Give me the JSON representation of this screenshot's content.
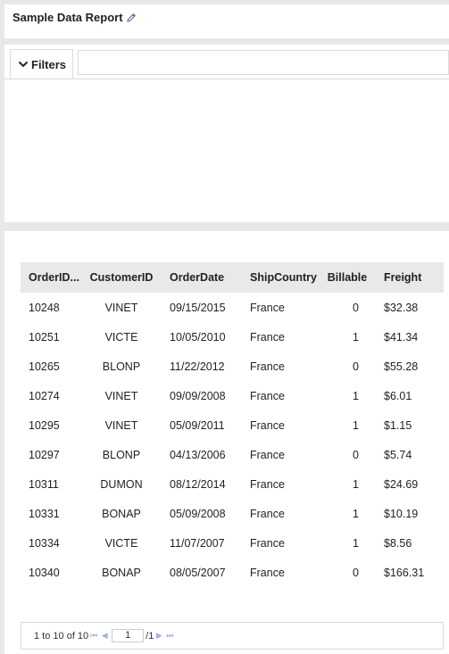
{
  "report": {
    "title": "Sample Data Report",
    "edit_icon": "pencil-icon"
  },
  "filters": {
    "label": "Filters",
    "toggle_icon": "chevron-down-icon"
  },
  "grid": {
    "columns": [
      "OrderID...",
      "CustomerID",
      "OrderDate",
      "ShipCountry",
      "Billable",
      "Freight"
    ],
    "rows": [
      [
        "10248",
        "VINET",
        "09/15/2015",
        "France",
        "0",
        "$32.38"
      ],
      [
        "10251",
        "VICTE",
        "10/05/2010",
        "France",
        "1",
        "$41.34"
      ],
      [
        "10265",
        "BLONP",
        "11/22/2012",
        "France",
        "0",
        "$55.28"
      ],
      [
        "10274",
        "VINET",
        "09/09/2008",
        "France",
        "1",
        "$6.01"
      ],
      [
        "10295",
        "VINET",
        "05/09/2011",
        "France",
        "1",
        "$1.15"
      ],
      [
        "10297",
        "BLONP",
        "04/13/2006",
        "France",
        "0",
        "$5.74"
      ],
      [
        "10311",
        "DUMON",
        "08/12/2014",
        "France",
        "1",
        "$24.69"
      ],
      [
        "10331",
        "BONAP",
        "05/09/2008",
        "France",
        "1",
        "$10.19"
      ],
      [
        "10334",
        "VICTE",
        "11/07/2007",
        "France",
        "1",
        "$8.56"
      ],
      [
        "10340",
        "BONAP",
        "08/05/2007",
        "France",
        "0",
        "$166.31"
      ]
    ]
  },
  "pager": {
    "summary": "1 to 10 of 10",
    "page_value": "1",
    "page_total": "/1",
    "first_icon": "first-page-icon",
    "prev_icon": "prev-page-icon",
    "next_icon": "next-page-icon",
    "last_icon": "last-page-icon"
  }
}
